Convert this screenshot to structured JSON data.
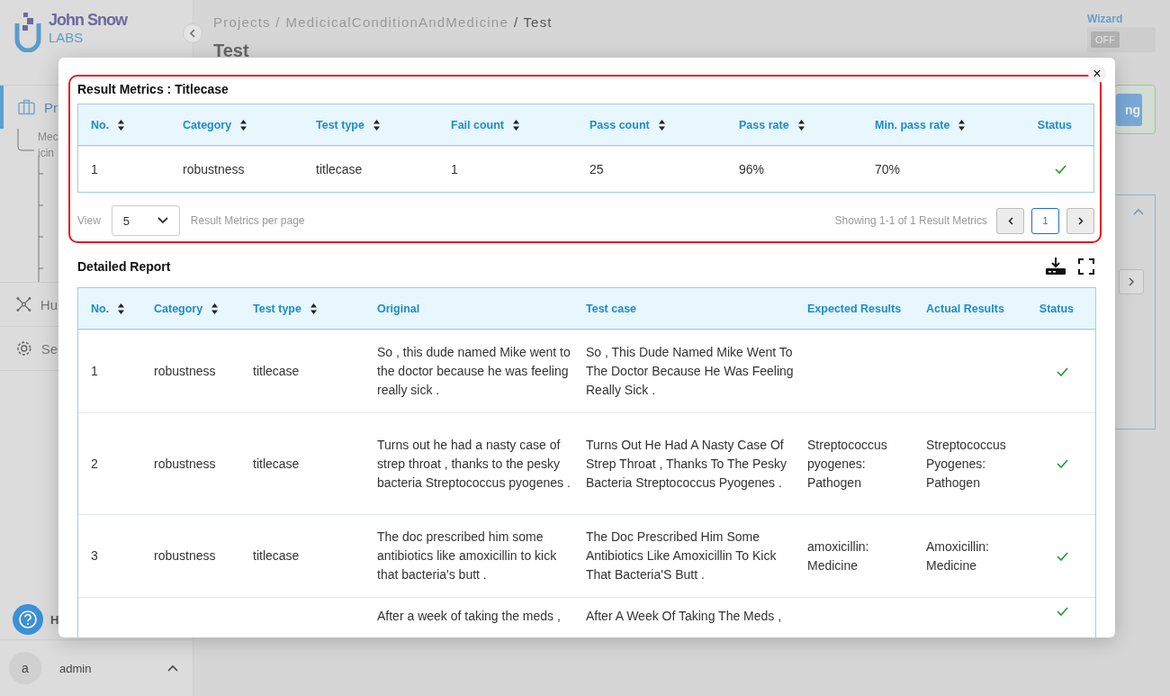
{
  "sidebar": {
    "logo": {
      "name": "John Snow",
      "sub": "LABS"
    },
    "items": [
      {
        "label": "Pr",
        "selected": true
      },
      {
        "label": "Hu",
        "selected": false
      },
      {
        "label": "Se",
        "selected": false
      }
    ],
    "tree_item": [
      "Mec",
      "icin"
    ],
    "help": {
      "label": "H"
    },
    "user": {
      "avatar": "a",
      "name": "admin"
    }
  },
  "header": {
    "breadcrumb": [
      {
        "label": "Projects /",
        "current": false
      },
      {
        "label": "MedicicalConditionAndMedicine",
        "current": false
      },
      {
        "label": "/ Test",
        "current": true
      }
    ],
    "title": "Test",
    "wizard": {
      "label": "Wizard",
      "state": "OFF",
      "on": false
    },
    "run_button": "ng"
  },
  "modal": {
    "close": "×",
    "metrics": {
      "title": "Result Metrics : Titlecase",
      "columns": [
        {
          "label": "No.",
          "sortable": true
        },
        {
          "label": "Category",
          "sortable": true
        },
        {
          "label": "Test type",
          "sortable": true
        },
        {
          "label": "Fail count",
          "sortable": true
        },
        {
          "label": "Pass count",
          "sortable": true
        },
        {
          "label": "Pass rate",
          "sortable": true
        },
        {
          "label": "Min. pass rate",
          "sortable": true
        },
        {
          "label": "Status",
          "sortable": false
        }
      ],
      "rows": [
        {
          "cells": [
            "1",
            "robustness",
            "titlecase",
            "1",
            "25",
            "96%",
            "70%"
          ],
          "passed": true
        }
      ],
      "view_label": "View",
      "page_size": "5",
      "per_page_label": "Result Metrics per page",
      "showing": "Showing 1-1 of 1 Result Metrics",
      "pages": [
        {
          "label": "1",
          "selected": true
        }
      ]
    },
    "report": {
      "title": "Detailed Report",
      "columns": [
        {
          "label": "No.",
          "sortable": true
        },
        {
          "label": "Category",
          "sortable": true
        },
        {
          "label": "Test type",
          "sortable": true
        },
        {
          "label": "Original",
          "sortable": false
        },
        {
          "label": "Test case",
          "sortable": false
        },
        {
          "label": "Expected Results",
          "sortable": false
        },
        {
          "label": "Actual Results",
          "sortable": false
        },
        {
          "label": "Status",
          "sortable": false
        }
      ],
      "rows": [
        {
          "cells": [
            "1",
            "robustness",
            "titlecase",
            "So , this dude named Mike went to the doctor because he was feeling really sick .",
            "So , This Dude Named Mike Went To The Doctor Because He Was Feeling Really Sick .",
            "",
            ""
          ],
          "passed": true
        },
        {
          "cells": [
            "2",
            "robustness",
            "titlecase",
            "Turns out he had a nasty case of strep throat , thanks to the pesky bacteria Streptococcus pyogenes .",
            "Turns Out He Had A Nasty Case Of Strep Throat , Thanks To The Pesky Bacteria Streptococcus Pyogenes .",
            "Streptococcus pyogenes: Pathogen",
            "Streptococcus Pyogenes: Pathogen"
          ],
          "passed": true
        },
        {
          "cells": [
            "3",
            "robustness",
            "titlecase",
            "The doc prescribed him some antibiotics like amoxicillin to kick that bacteria's butt .",
            "The Doc Prescribed Him Some Antibiotics Like Amoxicillin To Kick That Bacteria'S Butt .",
            "amoxicillin: Medicine",
            "Amoxicillin: Medicine"
          ],
          "passed": true
        },
        {
          "cells": [
            "",
            "",
            "",
            "After a week of taking the meds ,",
            "After A Week Of Taking The Meds ,",
            "",
            ""
          ],
          "passed": true
        }
      ]
    }
  }
}
